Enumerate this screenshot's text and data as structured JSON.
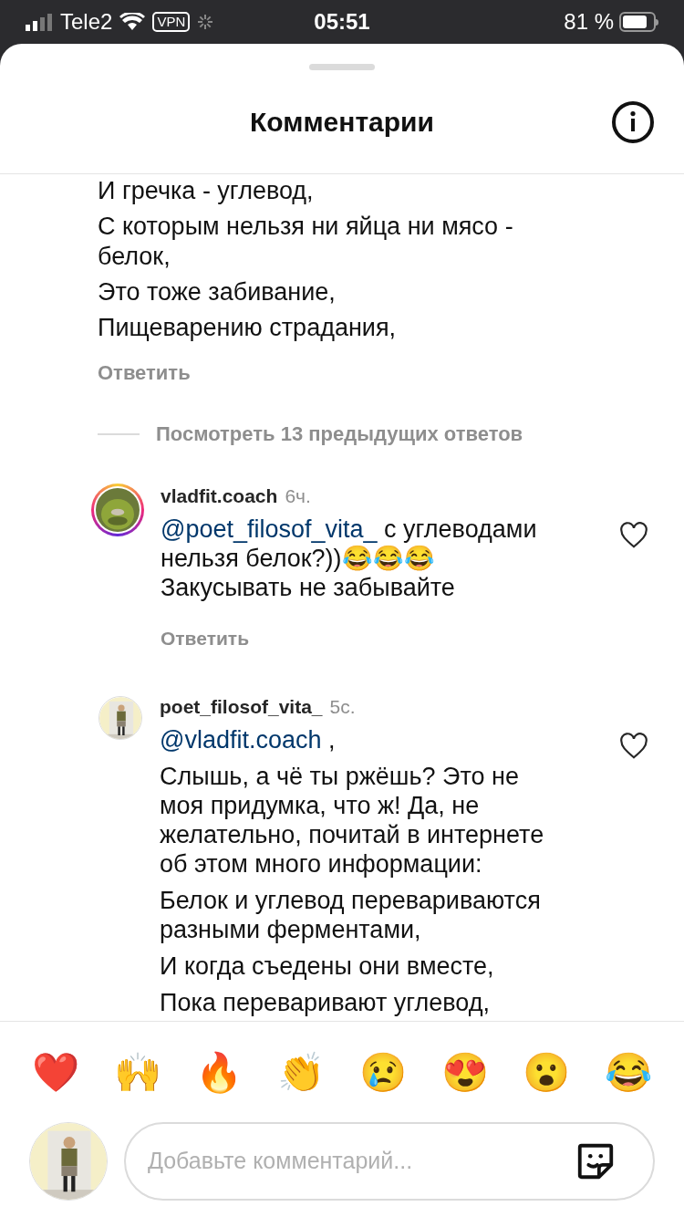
{
  "status_bar": {
    "carrier": "Tele2",
    "vpn": "VPN",
    "time": "05:51",
    "battery": "81 %"
  },
  "header": {
    "title": "Комментарии"
  },
  "parent_comment": {
    "paragraphs": [
      "И гречка - углевод,",
      "С которым нельзя ни яйца ни мясо - белок,",
      "Это тоже забивание,",
      "Пищеварению страдания,"
    ],
    "reply": "Ответить"
  },
  "view_replies": "Посмотреть 13 предыдущих ответов",
  "comments": [
    {
      "username": "vladfit.coach",
      "time": "6ч.",
      "has_story": true,
      "paragraphs": [
        {
          "mention": "@poet_filosof_vita_",
          "text": " с углеводами нельзя белок?))😂😂😂\nЗакусывать не забывайте"
        }
      ],
      "reply": "Ответить",
      "liked": false
    },
    {
      "username": "poet_filosof_vita_",
      "time": "5с.",
      "has_story": false,
      "paragraphs": [
        {
          "mention": "@vladfit.coach",
          "text": " ,"
        },
        {
          "text": "Слышь, а чё ты ржёшь? Это не моя придумка, что ж! Да, не желательно, почитай в интернете об этом много информации:"
        },
        {
          "text": "Белок и углевод перевариваются разными ферментами,"
        },
        {
          "text": "И когда съедены они вместе,"
        },
        {
          "text": "Пока переваривают углевод,"
        }
      ],
      "liked": false
    }
  ],
  "reactions": [
    "❤️",
    "🙌",
    "🔥",
    "👏",
    "😢",
    "😍",
    "😮",
    "😂"
  ],
  "comment_input": {
    "placeholder": "Добавьте комментарий..."
  }
}
